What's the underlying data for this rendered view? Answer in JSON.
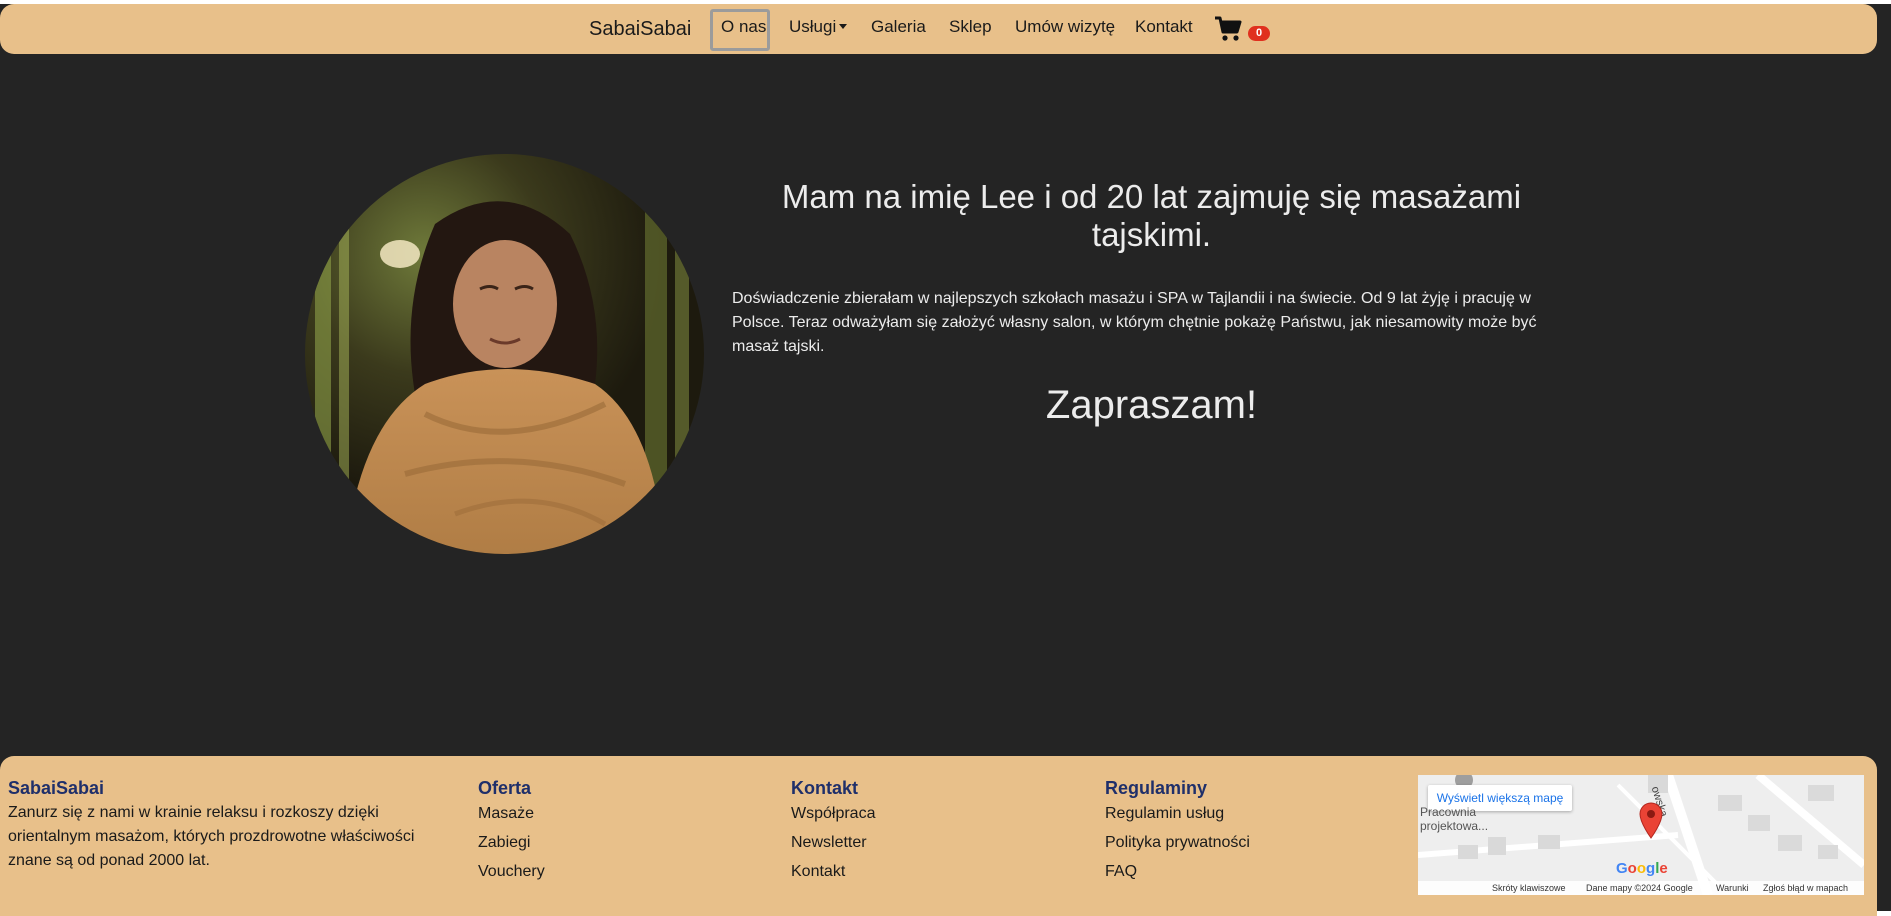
{
  "nav": {
    "brand": "SabaiSabai",
    "items": [
      "O nas",
      "Usługi",
      "Galeria",
      "Sklep",
      "Umów wizytę",
      "Kontakt"
    ],
    "cart_count": "0"
  },
  "hero": {
    "headline": "Mam na imię Lee i od 20 lat zajmuję się masażami tajskimi.",
    "lead": "Doświadczenie zbierałam w najlepszych szkołach masażu i SPA w Tajlandii i na świecie. Od 9 lat żyję i pracuję w Polsce. Teraz odważyłam się założyć własny salon, w którym chętnie pokażę Państwu, jak niesamowity może być masaż tajski.",
    "invite": "Zapraszam!"
  },
  "footer": {
    "about": {
      "title": "SabaiSabai",
      "text": "Zanurz się z nami w krainie relaksu i rozkoszy dzięki orientalnym masażom, których prozdrowotne właściwości znane są od ponad 2000 lat."
    },
    "oferta": {
      "title": "Oferta",
      "links": [
        "Masaże",
        "Zabiegi",
        "Vouchery"
      ]
    },
    "kontakt": {
      "title": "Kontakt",
      "links": [
        "Współpraca",
        "Newsletter",
        "Kontakt"
      ]
    },
    "regulaminy": {
      "title": "Regulaminy",
      "links": [
        "Regulamin usług",
        "Polityka prywatności",
        "FAQ"
      ]
    }
  },
  "map": {
    "button": "Wyświetl większą mapę",
    "place": "Pracownia projektowa...",
    "street": "owska",
    "logo": "Google",
    "shortcuts": "Skróty klawiszowe",
    "data": "Dane mapy ©2024 Google",
    "terms": "Warunki",
    "report": "Zgłoś błąd w mapach"
  },
  "colors": {
    "page_bg": "#242424",
    "bar_bg": "#e8c08a",
    "footer_heading": "#1f2f6a",
    "badge": "#e0301e"
  },
  "icons": [
    "cart-icon",
    "map-pin-icon",
    "caret-down-icon"
  ]
}
